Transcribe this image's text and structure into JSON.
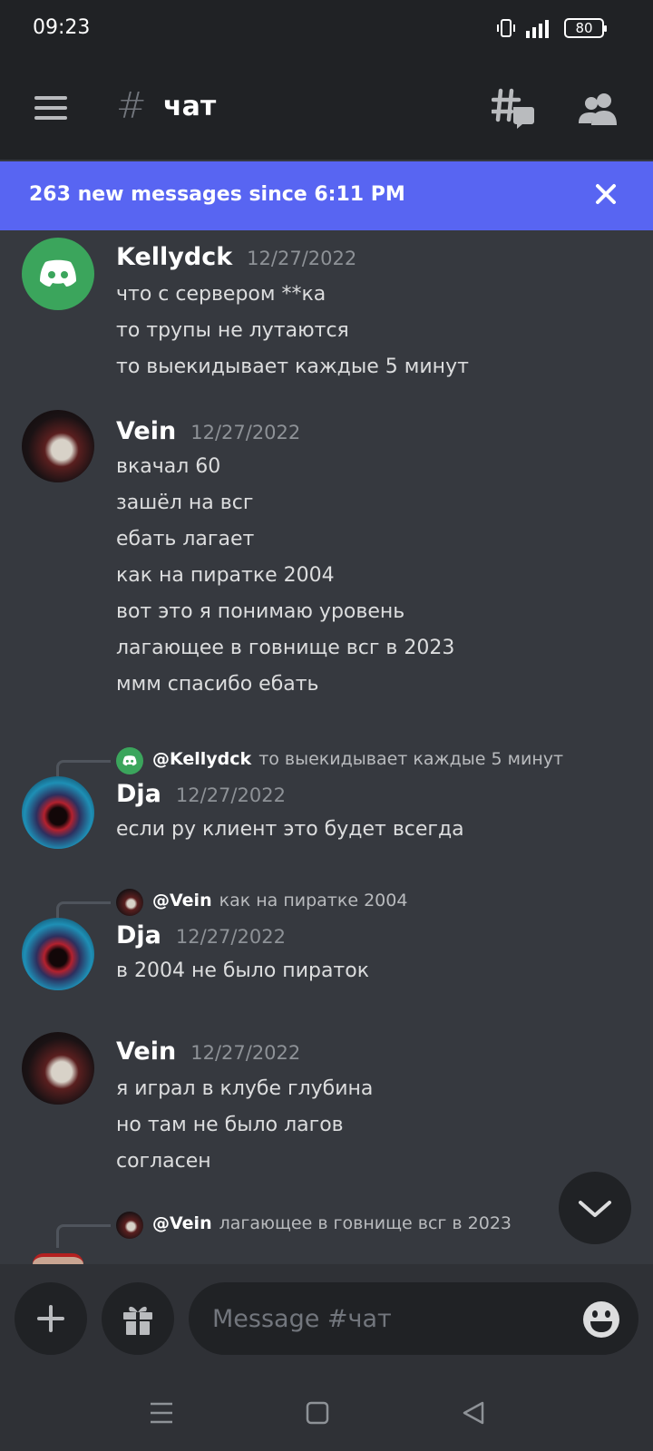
{
  "status": {
    "time": "09:23",
    "battery": "80"
  },
  "header": {
    "channel_name": "чат",
    "hash": "#"
  },
  "new_messages": {
    "text": "263 new messages since 6:11 PM"
  },
  "messages": [
    {
      "author": "Kellydck",
      "timestamp": "12/27/2022",
      "lines": [
        "что с сервером  **ка",
        "то трупы не лутаются",
        "то выекидывает каждые 5 минут"
      ]
    },
    {
      "author": "Vein",
      "timestamp": "12/27/2022",
      "lines": [
        "вкачал 60",
        "зашёл на всг",
        "ебать лагает",
        "как на пиратке 2004",
        "вот это я понимаю уровень",
        "лагающее в говнище всг в 2023",
        "ммм спасибо ебать"
      ]
    },
    {
      "reply": {
        "user": "@Kellydck",
        "text": "то выекидывает каждые 5 минут"
      },
      "author": "Dja",
      "timestamp": "12/27/2022",
      "lines": [
        "если ру клиент это будет всегда"
      ]
    },
    {
      "reply": {
        "user": "@Vein",
        "text": "как на пиратке 2004"
      },
      "author": "Dja",
      "timestamp": "12/27/2022",
      "lines": [
        "в 2004 не было пираток"
      ]
    },
    {
      "author": "Vein",
      "timestamp": "12/27/2022",
      "lines": [
        "я играл в клубе глубина",
        "но там не было лагов",
        "согласен"
      ]
    },
    {
      "reply": {
        "user": "@Vein",
        "text": "лагающее в говнище всг в 2023"
      }
    }
  ],
  "composer": {
    "placeholder": "Message #чат"
  },
  "colors": {
    "brand": "#5865f2",
    "discord_green": "#3ba55c",
    "background": "#36393f",
    "header": "#202225"
  },
  "icons": [
    "hamburger-icon",
    "threads-icon",
    "members-icon",
    "close-icon",
    "chevron-down-icon",
    "plus-icon",
    "gift-icon",
    "emoji-icon",
    "nav-menu-icon",
    "nav-home-icon",
    "nav-back-icon"
  ]
}
